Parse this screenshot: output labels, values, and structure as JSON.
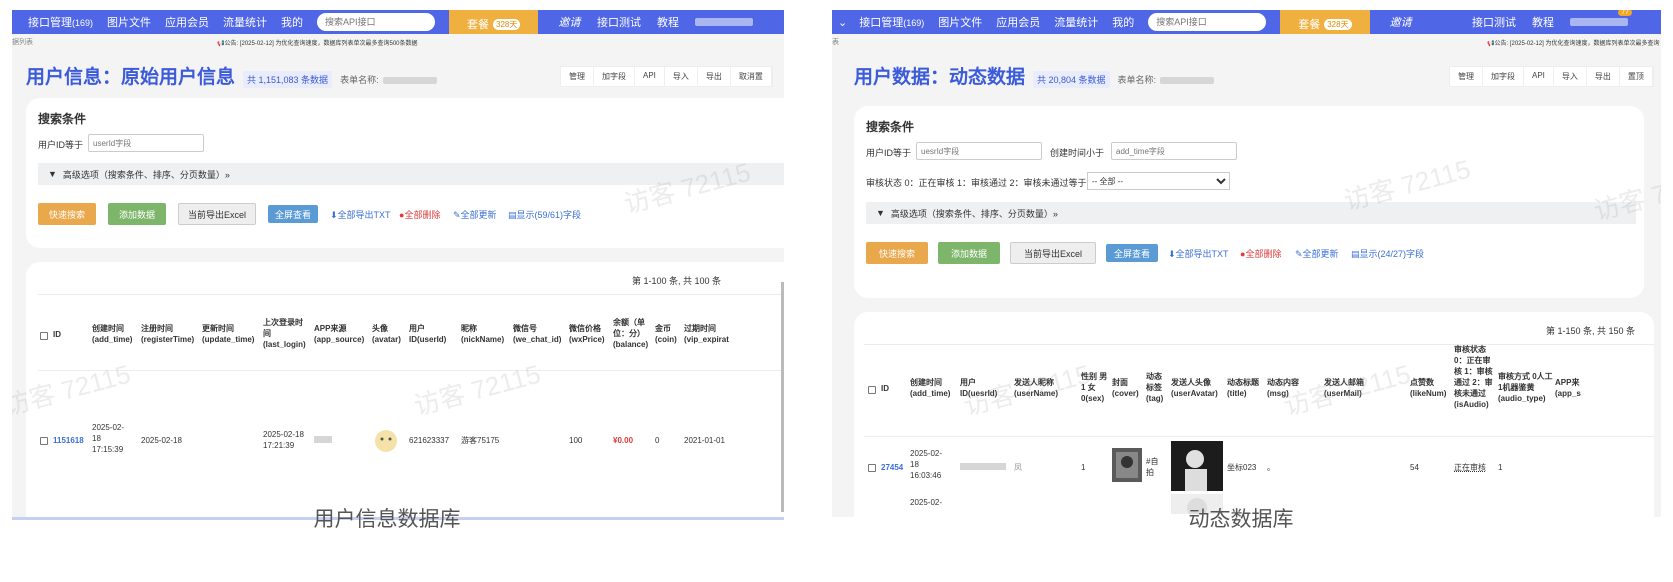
{
  "nav": {
    "menu_items": [
      "接口管理",
      "图片文件",
      "应用会员",
      "流量统计",
      "我的"
    ],
    "api_count": "(169)",
    "search_placeholder": "搜索API接口",
    "package_label": "套餐",
    "package_badge": "328天",
    "invite_label": "邀请",
    "api_test_label": "接口测试",
    "tutorial_label": "教程",
    "user_badge": "77"
  },
  "left_screen": {
    "breadcrumb": "据列表",
    "notice": "公告: [2025-02-12] 为优化查询速度，数据库列表单次最多查询500条数据",
    "title": "用户信息：原始用户信息",
    "record_count": "共 1,151,083 条数据",
    "table_name_label": "表单名称:",
    "tools": [
      "管理",
      "加字段",
      "API",
      "导入",
      "导出",
      "取消置"
    ],
    "search_title": "搜索条件",
    "filter_label": "用户ID等于",
    "filter_placeholder": "userId字段",
    "advanced_label": "高级选项（搜索条件、排序、分页数量）»",
    "btn_quick_search": "快速搜索",
    "btn_add": "添加数据",
    "btn_export_excel": "当前导出Excel",
    "btn_fullscreen": "全屏查看",
    "link_export_txt": "全部导出TXT",
    "link_delete_all": "全部删除",
    "link_update_all": "全部更新",
    "link_show_fields": "显示(59/61)字段",
    "pager": "第 1-100 条, 共 100 条",
    "columns": [
      "ID",
      "创建时间 (add_time)",
      "注册时间 (registerTime)",
      "更新时间 (update_time)",
      "上次登录时间 (last_login)",
      "APP来源 (app_source)",
      "头像 (avatar)",
      "用户 ID(userId)",
      "昵称 (nickName)",
      "微信号 (we_chat_id)",
      "微信价格 (wxPrice)",
      "余额（单位：分）(balance)",
      "金币 (coin)",
      "过期时间 (vip_expirat"
    ],
    "row": {
      "id": "1151618",
      "add_time": "2025-02-18 17:15:39",
      "register_time": "2025-02-18",
      "last_login": "2025-02-18 17:21:39",
      "user_id": "621623337",
      "nickname": "游客75175",
      "wx_price": "100",
      "balance": "¥0.00",
      "coin": "0",
      "vip_expire": "2021-01-01"
    },
    "watermark": "访客 72115"
  },
  "right_screen": {
    "breadcrumb": "表",
    "notice": "公告: [2025-02-12] 为优化查询速度，数据库列表单次最多查询",
    "title": "用户数据：动态数据",
    "record_count": "共 20,804 条数据",
    "table_name_label": "表单名称:",
    "tools": [
      "管理",
      "加字段",
      "API",
      "导入",
      "导出",
      "置顶"
    ],
    "search_title": "搜索条件",
    "filter1_label": "用户ID等于",
    "filter1_placeholder": "uesrId字段",
    "filter2_label": "创建时间小于",
    "filter2_placeholder": "add_time字段",
    "filter3_label": "审核状态 0：正在审核 1：审核通过 2：审核未通过等于",
    "filter3_value": "-- 全部 --",
    "advanced_label": "高级选项（搜索条件、排序、分页数量）»",
    "btn_quick_search": "快速搜索",
    "btn_add": "添加数据",
    "btn_export_excel": "当前导出Excel",
    "btn_fullscreen": "全屏查看",
    "link_export_txt": "全部导出TXT",
    "link_delete_all": "全部删除",
    "link_update_all": "全部更新",
    "link_show_fields": "显示(24/27)字段",
    "pager": "第 1-150 条, 共 150 条",
    "columns": [
      "ID",
      "创建时间 (add_time)",
      "用户 ID(uesrId)",
      "发送人昵称 (userName)",
      "性别 男1 女0(sex)",
      "封面 (cover)",
      "动态标签 (tag)",
      "发送人头像 (userAvatar)",
      "动态标题(title)",
      "动态内容 (msg)",
      "发送人邮箱 (userMail)",
      "点赞数 (likeNum)",
      "审核状态 0：正在审核 1：审核通过 2：审核未通过 (isAudio)",
      "审核方式 0人工 1机器鉴黄 (audio_type)",
      "APP来 (app_s"
    ],
    "row": {
      "id": "27454",
      "add_time": "2025-02-18 16:03:46",
      "username": "凤",
      "sex": "1",
      "tag": "#自拍",
      "title": "坐标023",
      "msg": "。",
      "like_num": "54",
      "audit_status": "正在审核",
      "audit_type": "1"
    },
    "next_row_partial": "2025-02-",
    "watermark": "访客 72115"
  },
  "captions": {
    "left": "用户信息数据库",
    "right": "动态数据库"
  }
}
